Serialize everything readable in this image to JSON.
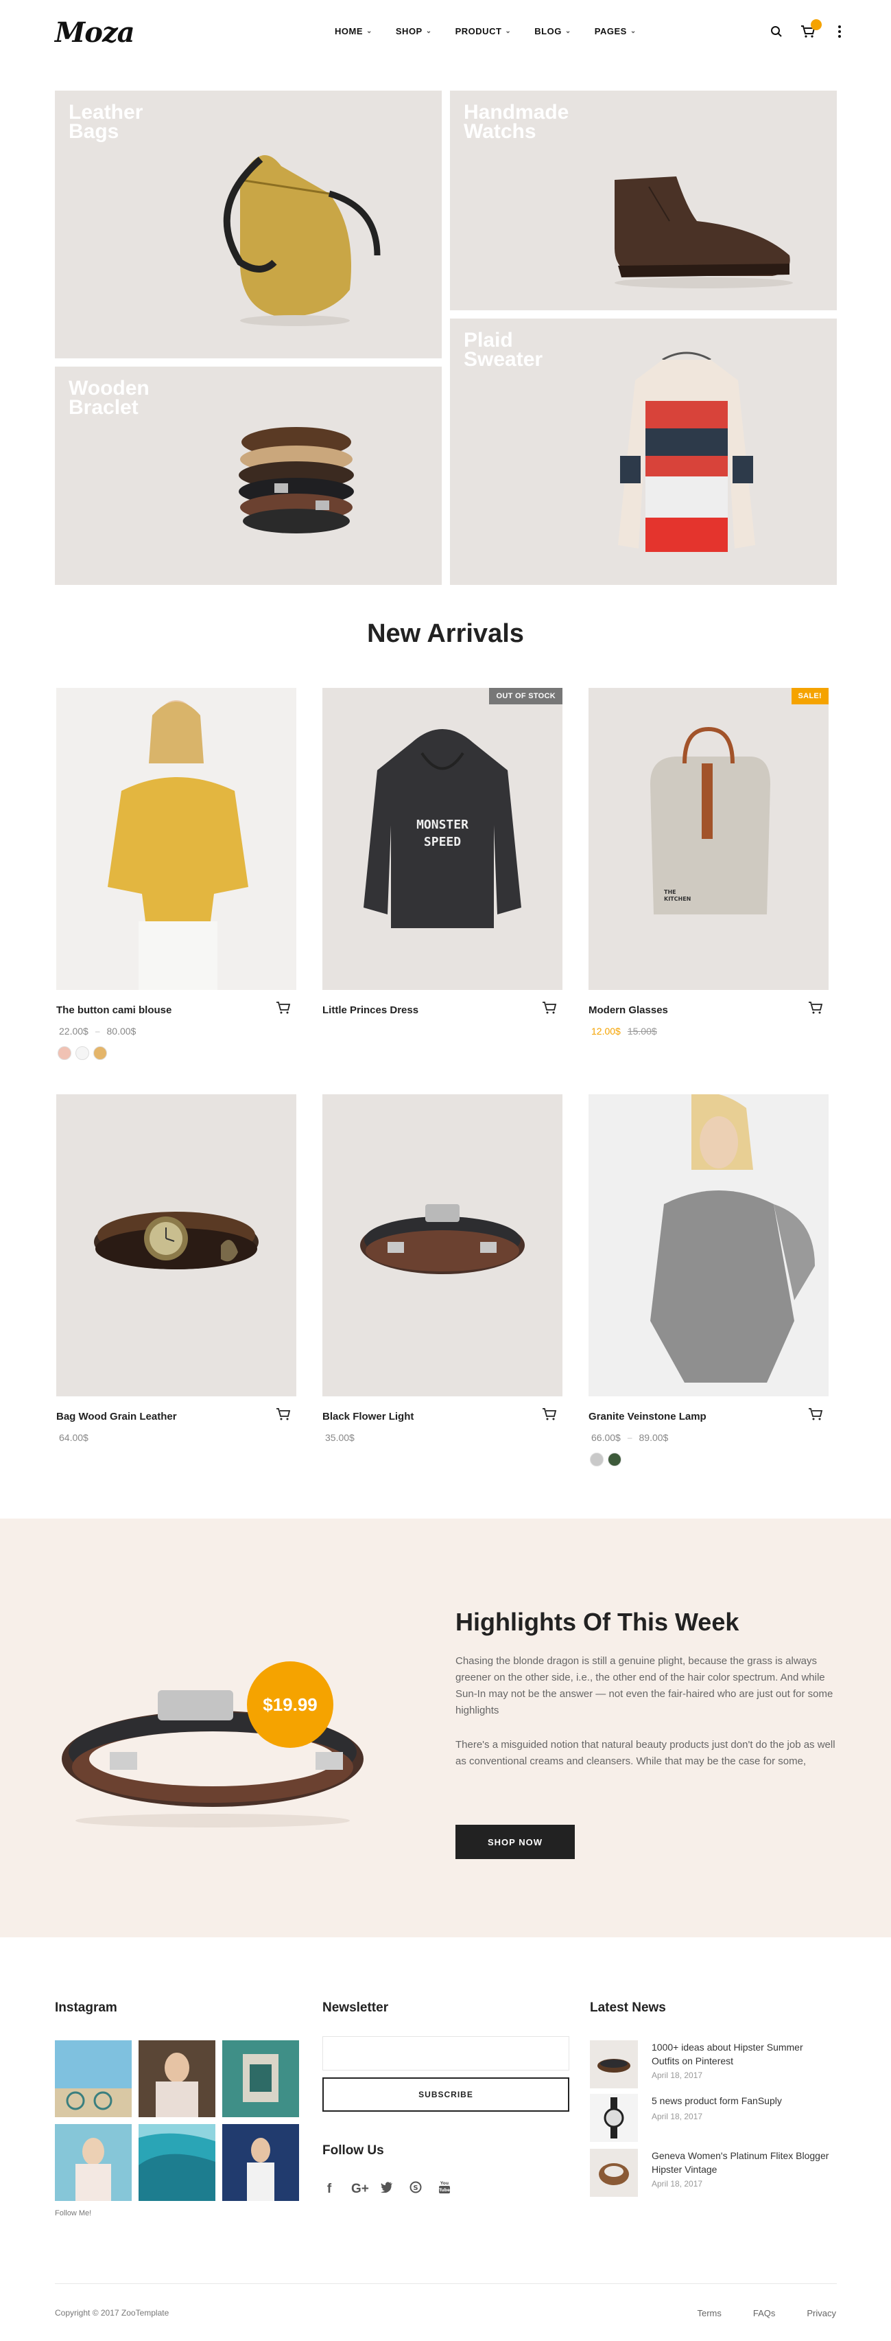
{
  "header": {
    "logo": "Moza",
    "nav": [
      {
        "label": "HOME"
      },
      {
        "label": "SHOP"
      },
      {
        "label": "PRODUCT"
      },
      {
        "label": "BLOG"
      },
      {
        "label": "PAGES"
      }
    ],
    "icons": [
      "search-icon",
      "cart-icon",
      "more-icon"
    ]
  },
  "banners": [
    {
      "title": "Leather\nBags"
    },
    {
      "title": "Handmade\nWatchs"
    },
    {
      "title": "Wooden\nBraclet"
    },
    {
      "title": "Plaid\nSweater"
    }
  ],
  "new_arrivals": {
    "title": "New Arrivals",
    "products": [
      {
        "name": "The button cami blouse",
        "price": "22.00$",
        "price2": "80.00$",
        "badge": ""
      },
      {
        "name": "Little Princes Dress",
        "price": "",
        "price2": "",
        "badge": "OUT OF STOCK"
      },
      {
        "name": "Modern Glasses",
        "price": "12.00$",
        "price2": "15.00$",
        "badge": "SALE!"
      },
      {
        "name": "Bag Wood Grain Leather",
        "price": "64.00$",
        "price2": "",
        "badge": ""
      },
      {
        "name": "Black Flower Light",
        "price": "35.00$",
        "price2": "",
        "badge": ""
      },
      {
        "name": "Granite Veinstone Lamp",
        "price": "66.00$",
        "price2": "89.00$",
        "badge": ""
      }
    ],
    "hoodie_text": "MONSTER\nSPEED",
    "bag_label": "THE\nKITCHEN"
  },
  "highlight": {
    "title": "Highlights Of This Week",
    "para1": "Chasing the blonde dragon is still a genuine plight, because the grass is always greener on the other side, i.e., the other end of the hair color spectrum. And while Sun-In may not be the answer — not even the fair-haired who are just out for some highlights",
    "para2": "There's a misguided notion that natural beauty products just don't do the job as well as conventional creams and cleansers. While that may be the case for some,",
    "button": "SHOP NOW",
    "price": "$19.99"
  },
  "footer": {
    "instagram_title": "Instagram",
    "follow_me": "Follow Me!",
    "newsletter_title": "Newsletter",
    "newsletter_placeholder": "",
    "subscribe": "SUBSCRIBE",
    "follow_us": "Follow Us",
    "social": [
      "f",
      "G+",
      "t",
      "S",
      "You"
    ],
    "news_title": "Latest News",
    "news": [
      {
        "title": "1000+ ideas about Hipster Summer Outfits on Pinterest",
        "date": "April 18, 2017"
      },
      {
        "title": "5 news product form FanSuply",
        "date": "April 18, 2017"
      },
      {
        "title": "Geneva Women's Platinum Flitex Blogger Hipster Vintage",
        "date": "April 18, 2017"
      }
    ],
    "copyright": "Copyright © 2017 ZooTemplate",
    "links": [
      "Terms",
      "FAQs",
      "Privacy"
    ]
  },
  "colors": {
    "accent": "#f5a300",
    "dark": "#222222",
    "banner_bg": "#e7e3e0",
    "highlight_bg": "#f7efe9"
  }
}
